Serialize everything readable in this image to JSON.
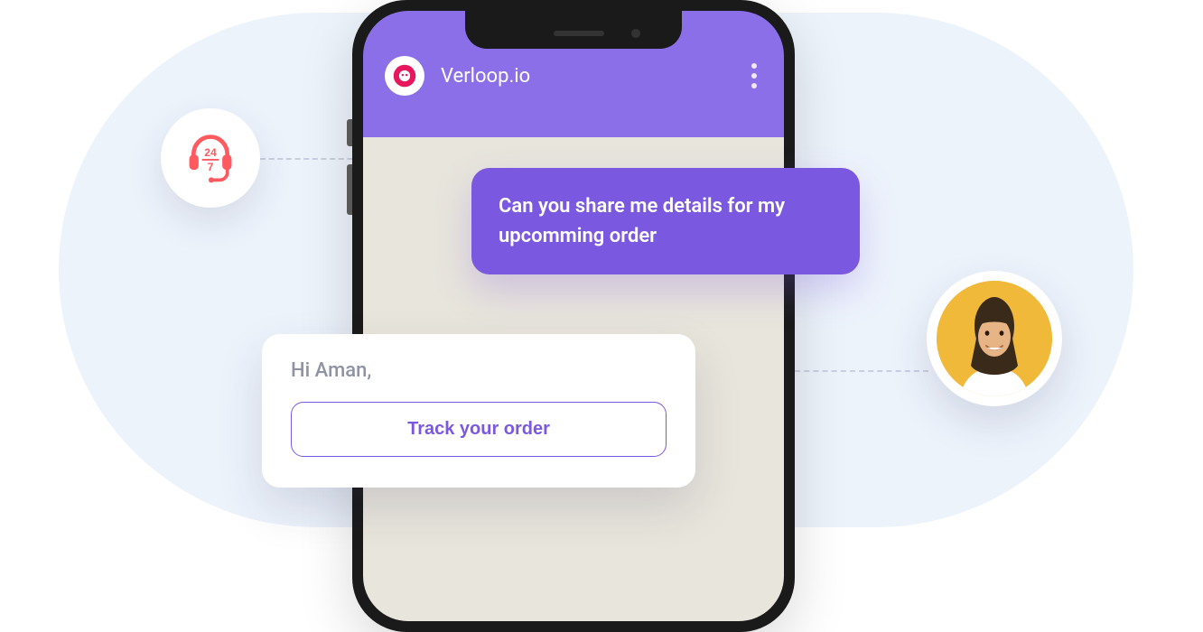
{
  "brand": {
    "name": "Verloop.io"
  },
  "support_icon": {
    "top_text": "24",
    "bottom_text": "7"
  },
  "user_message": "Can you share me details for my upcomming order",
  "bot_card": {
    "greeting": "Hi Aman,",
    "cta": "Track your order"
  }
}
